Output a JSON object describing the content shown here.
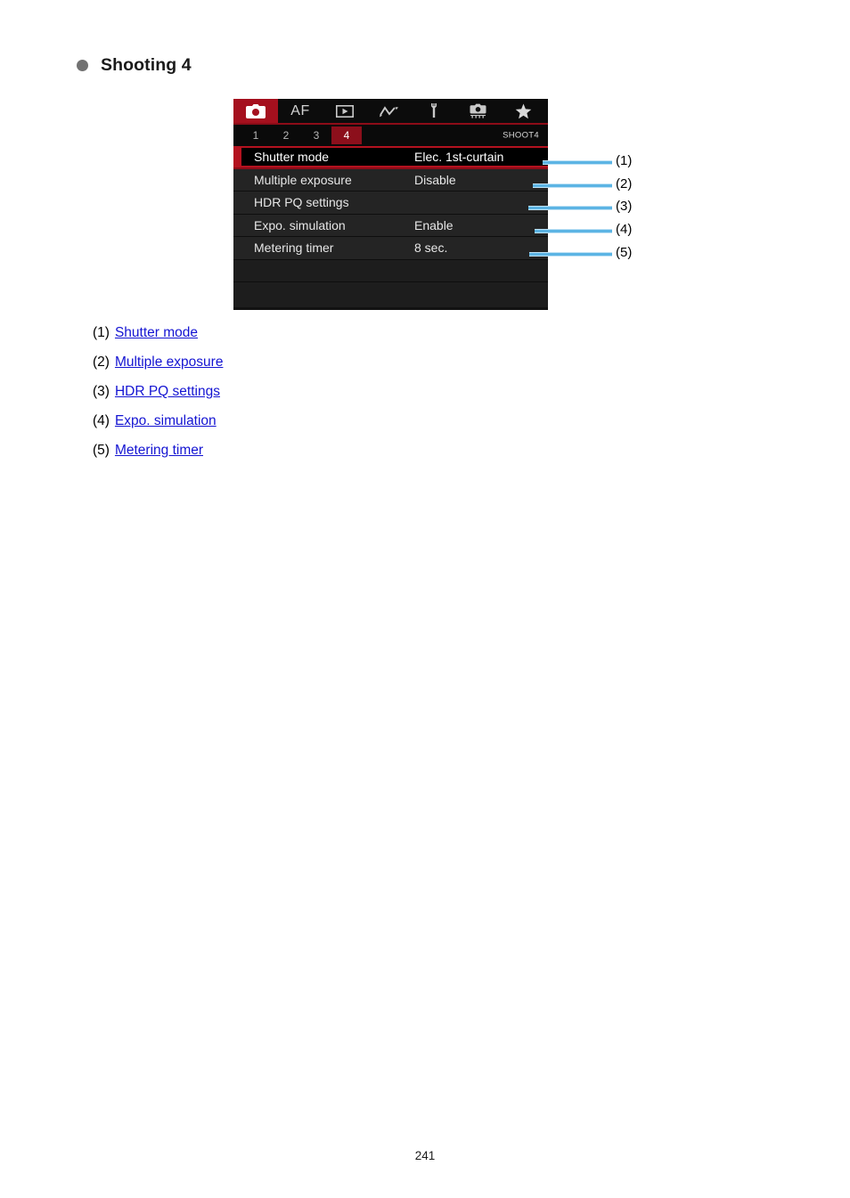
{
  "heading": {
    "bullet_icon": "bullet-dot-icon",
    "title": "Shooting 4"
  },
  "camera_menu": {
    "tabs": [
      {
        "icon": "camera-icon",
        "label": "",
        "active": true
      },
      {
        "icon": "af-text-icon",
        "label": "AF",
        "active": false
      },
      {
        "icon": "playback-icon",
        "label": "",
        "active": false
      },
      {
        "icon": "wireless-icon",
        "label": "",
        "active": false
      },
      {
        "icon": "wrench-icon",
        "label": "",
        "active": false
      },
      {
        "icon": "custom-functions-icon",
        "label": "",
        "active": false
      },
      {
        "icon": "star-icon",
        "label": "",
        "active": false
      }
    ],
    "subtabs": [
      {
        "label": "1",
        "active": false
      },
      {
        "label": "2",
        "active": false
      },
      {
        "label": "3",
        "active": false
      },
      {
        "label": "4",
        "active": true
      }
    ],
    "screen_label": "SHOOT4",
    "rows": [
      {
        "label": "Shutter mode",
        "value": "Elec. 1st-curtain",
        "selected": true
      },
      {
        "label": "Multiple exposure",
        "value": "Disable",
        "selected": false
      },
      {
        "label": "HDR PQ settings",
        "value": "",
        "selected": false
      },
      {
        "label": "Expo. simulation",
        "value": "Enable",
        "selected": false
      },
      {
        "label": "Metering timer",
        "value": "8 sec.",
        "selected": false
      }
    ]
  },
  "callouts": [
    {
      "number": "(1)"
    },
    {
      "number": "(2)"
    },
    {
      "number": "(3)"
    },
    {
      "number": "(4)"
    },
    {
      "number": "(5)"
    }
  ],
  "links": [
    {
      "index": "(1)",
      "text": "Shutter mode"
    },
    {
      "index": "(2)",
      "text": "Multiple exposure"
    },
    {
      "index": "(3)",
      "text": "HDR PQ settings"
    },
    {
      "index": "(4)",
      "text": "Expo. simulation"
    },
    {
      "index": "(5)",
      "text": "Metering timer"
    }
  ],
  "footer": {
    "page_number": "241"
  },
  "colors": {
    "accent_red": "#b4121f",
    "tab_red": "#a5101e",
    "callout_blue": "#5cb4e4",
    "link_blue": "#1414d2"
  }
}
